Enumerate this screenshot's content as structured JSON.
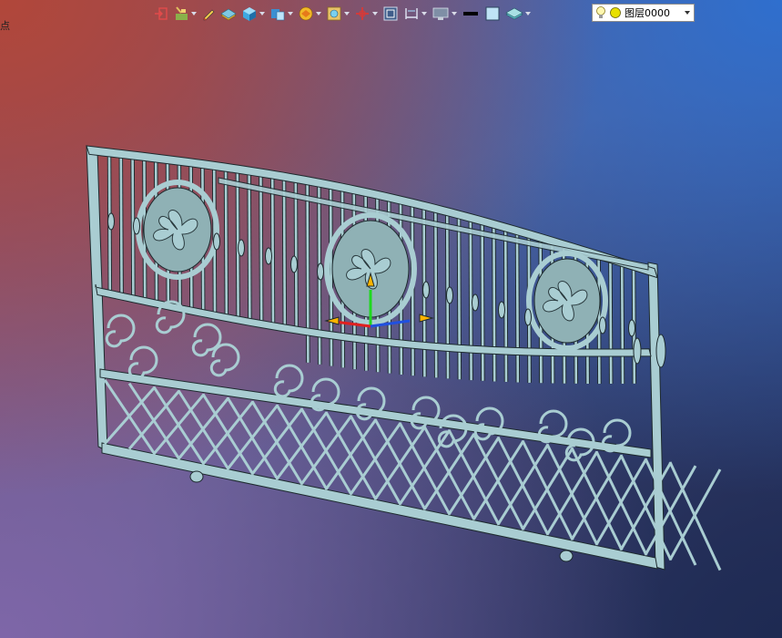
{
  "window": {
    "corner_glyph": "点"
  },
  "toolbar": {
    "buttons": [
      {
        "name": "exit-icon",
        "dropdown": false
      },
      {
        "name": "draw-tool-icon",
        "dropdown": true
      },
      {
        "name": "pen-icon",
        "dropdown": false
      },
      {
        "name": "plane-icon",
        "dropdown": false
      },
      {
        "name": "solid-box-icon",
        "dropdown": true
      },
      {
        "name": "view-cube-icon",
        "dropdown": true
      },
      {
        "name": "section-icon",
        "dropdown": true
      },
      {
        "name": "snap-icon",
        "dropdown": true
      },
      {
        "name": "coordinate-icon",
        "dropdown": true
      },
      {
        "name": "zoom-window-icon",
        "dropdown": false
      },
      {
        "name": "dimension-icon",
        "dropdown": true
      },
      {
        "name": "display-icon",
        "dropdown": true
      },
      {
        "name": "line-color-swatch",
        "dropdown": false
      },
      {
        "name": "fill-color-swatch",
        "dropdown": false
      },
      {
        "name": "material-icon",
        "dropdown": true
      }
    ],
    "colors": {
      "line": "#000000",
      "fill": "#bfe3f5",
      "accent": "#ffb300"
    }
  },
  "layer": {
    "label": "图层0000",
    "bulb": "light-bulb-icon",
    "status_color": "#e8e000"
  },
  "model": {
    "description_color": "#a9cdd2"
  }
}
